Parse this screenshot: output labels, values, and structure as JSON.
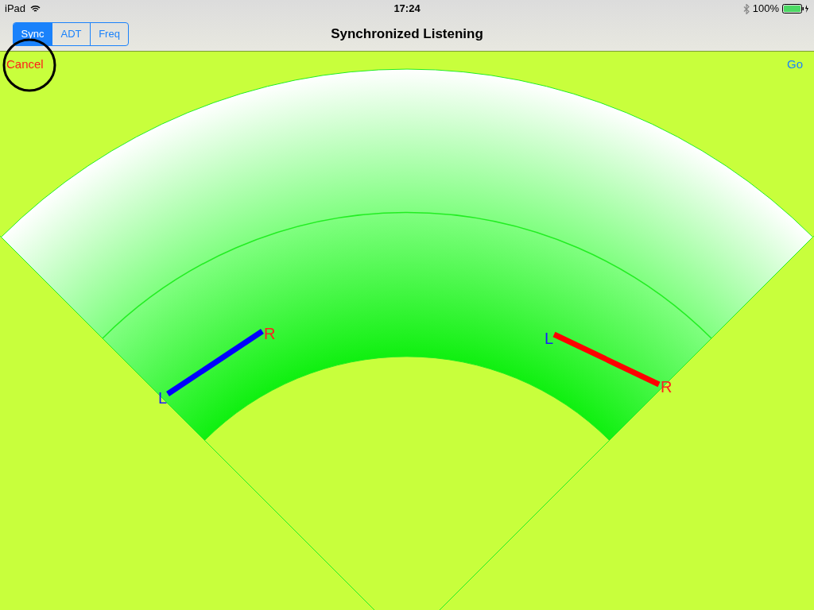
{
  "status_bar": {
    "device": "iPad",
    "time": "17:24",
    "battery": "100%"
  },
  "nav_bar": {
    "segments": [
      {
        "label": "Sync",
        "selected": true
      },
      {
        "label": "ADT",
        "selected": false
      },
      {
        "label": "Freq",
        "selected": false
      }
    ],
    "title": "Synchronized Listening"
  },
  "toolbar": {
    "cancel": "Cancel",
    "go": "Go"
  },
  "speakers": [
    {
      "color": "#0000ff",
      "left_label": "L",
      "right_label": "R"
    },
    {
      "color": "#ff0000",
      "left_label": "L",
      "right_label": "R"
    }
  ]
}
